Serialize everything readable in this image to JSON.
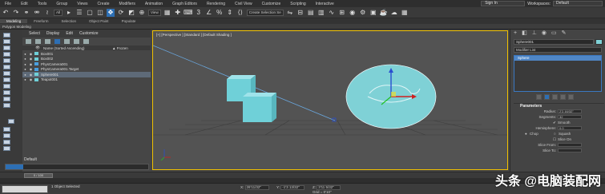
{
  "menus": [
    "File",
    "Edit",
    "Tools",
    "Group",
    "Views",
    "Create",
    "Modifiers",
    "Animation",
    "Graph Editors",
    "Rendering",
    "Civil View",
    "Customize",
    "Scripting",
    "Interactive"
  ],
  "signin": "Sign In",
  "workspace_label": "Workspaces:",
  "workspace": "Default",
  "toolbar": {
    "filter": "All",
    "view": "View",
    "selection_set": "Create Selection Se"
  },
  "ribbon": {
    "tabs": [
      "Modeling",
      "Freeform",
      "Selection",
      "Object Paint",
      "Populate"
    ],
    "sub": "Polygon Modeling"
  },
  "explorer": {
    "menu": [
      "Select",
      "Display",
      "Edit",
      "Customize"
    ],
    "header_name": "Name (Sorted Ascending)",
    "header_frozen": "▲ Frozen",
    "rows": [
      {
        "name": "Box001",
        "color": "#6fd0d8"
      },
      {
        "name": "Box002",
        "color": "#6fd0d8"
      },
      {
        "name": "PhysCamera001",
        "color": "#4aa0e0"
      },
      {
        "name": "PhysCamera001.Target",
        "color": "#4aa0e0"
      },
      {
        "name": "Sphere001",
        "color": "#6fd0d8"
      },
      {
        "name": "Teapot001",
        "color": "#6fd0d8"
      }
    ],
    "default": "Default"
  },
  "viewport": {
    "label": "[+] [Perspective ] [Standard ] [Default Shading ]"
  },
  "command_panel": {
    "name": "Sphere001",
    "modifier_list": "Modifier List",
    "stack_item": "Sphere",
    "params_title": "Parameters",
    "params": [
      {
        "label": "Radius:",
        "value": "2'2.16/32\""
      },
      {
        "label": "Segments:",
        "value": "32"
      }
    ],
    "smooth": "Smooth",
    "hemisphere_label": "Hemisphere:",
    "hemisphere_value": "0.0",
    "chop": "Chop",
    "squash": "Squash",
    "slice_on": "Slice On",
    "slice_from": "Slice From:",
    "slice_to": "Slice To:"
  },
  "timeline": {
    "frame": "0 / 100"
  },
  "status": {
    "selected": "1 Object Selected",
    "x_label": "X:",
    "x": "26'11/32\"",
    "y_label": "Y:",
    "y": "-1'3 13/32\"",
    "z_label": "Z:",
    "z": "3'11 5/32\"",
    "grid": "Grid = 0'10\""
  },
  "watermark": "头条 @电脑装配网"
}
